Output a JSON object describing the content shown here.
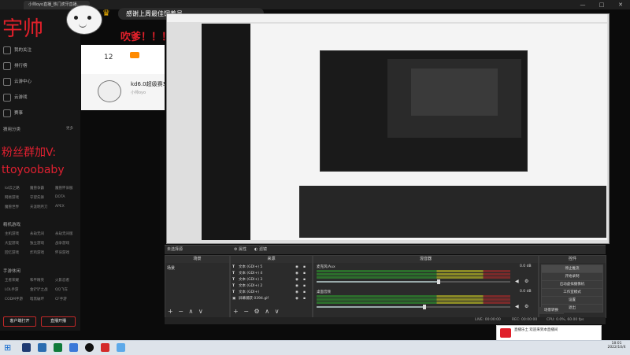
{
  "browser": {
    "tab_title": "小帅oyo直播_热门虎牙直播...",
    "minimize": "—",
    "maximize": "□",
    "close": "✕"
  },
  "overlay": {
    "banner": "感谢上周最佳饲养员",
    "streamer_name": "宇帅",
    "shout": "吹爹！！！",
    "fan_group_line1": "粉丝群加V:",
    "fan_group_line2": "ttoyoobaby"
  },
  "site": {
    "follow_count": "12",
    "room_title": "kd6.0超级赛车",
    "room_sub": "小帅oyo"
  },
  "sidebar": {
    "nav": [
      {
        "label": "我的关注",
        "icon": "heart-icon"
      },
      {
        "label": "排行榜",
        "icon": "rank-icon"
      },
      {
        "label": "云游中心",
        "icon": "cloud-icon"
      },
      {
        "label": "云游戏",
        "icon": "gamepad-icon"
      },
      {
        "label": "赛事",
        "icon": "trophy-icon"
      }
    ],
    "category_head": "猜用分类",
    "category_more": "更多",
    "categories": [
      "lol云之路",
      "魔兽争霸",
      "魔兽怀旧服",
      "网易游戏",
      "守望先锋",
      "DOTA",
      "魔兽世界",
      "天涯明月刀",
      "APEX"
    ],
    "section2_head": "精机游戏",
    "section2_items": [
      "主机游戏",
      "永劫无间",
      "永劫无间版",
      "大型游戏",
      "独立游戏",
      "战争游戏",
      "回忆游戏",
      "炸鸡游戏",
      "怀旧游戏"
    ],
    "section3_head": "手游休闲",
    "section3_items": [
      "王者荣耀",
      "和平精英",
      "火影忍者",
      "LOL手游",
      "金铲铲之战",
      "QQ飞车",
      "CODM手游",
      "暗黑破坏",
      "CF手游"
    ],
    "btn_left": "客户端打开",
    "btn_right": "直播开播"
  },
  "obs": {
    "scene_header": "未选择源",
    "tab_props": "属性",
    "tab_filters": "滤镜",
    "panels": {
      "scenes": "场景",
      "sources": "来源",
      "mixer": "混音器",
      "controls": "控件"
    },
    "scenes": [
      "场景"
    ],
    "sources": [
      "文本 (GDI+) 5",
      "文本 (GDI+) 4",
      "文本 (GDI+) 3",
      "文本 (GDI+) 2",
      "文本 (GDI+)",
      "屏幕捕获 0394.gif"
    ],
    "mixer_tracks": [
      {
        "name": "麦克风/Aux",
        "db": "0.0 dB",
        "level": 0.62
      },
      {
        "name": "桌面音频",
        "db": "0.0 dB",
        "level": 0.55
      }
    ],
    "controls": [
      "停止推流",
      "开始录制",
      "启动虚拟摄像机",
      "工作室模式",
      "设置",
      "退出"
    ],
    "transitions": "场景转换",
    "status": {
      "dropped": "LIVE: 00:00:00",
      "rec": "REC: 00:00:00",
      "cpu": "CPU: 0.0%, 60.00 fps"
    }
  },
  "notification": {
    "title": "直播乐土 欢迎来到本直播间",
    "sub": "欢迎来到本直播间"
  },
  "taskbar": {
    "time": "18:01",
    "date": "2022/10/4"
  },
  "colors": {
    "accent_red": "#e0202a",
    "obs_bg": "#2b2b2b",
    "sidebar_bg": "#161616"
  }
}
